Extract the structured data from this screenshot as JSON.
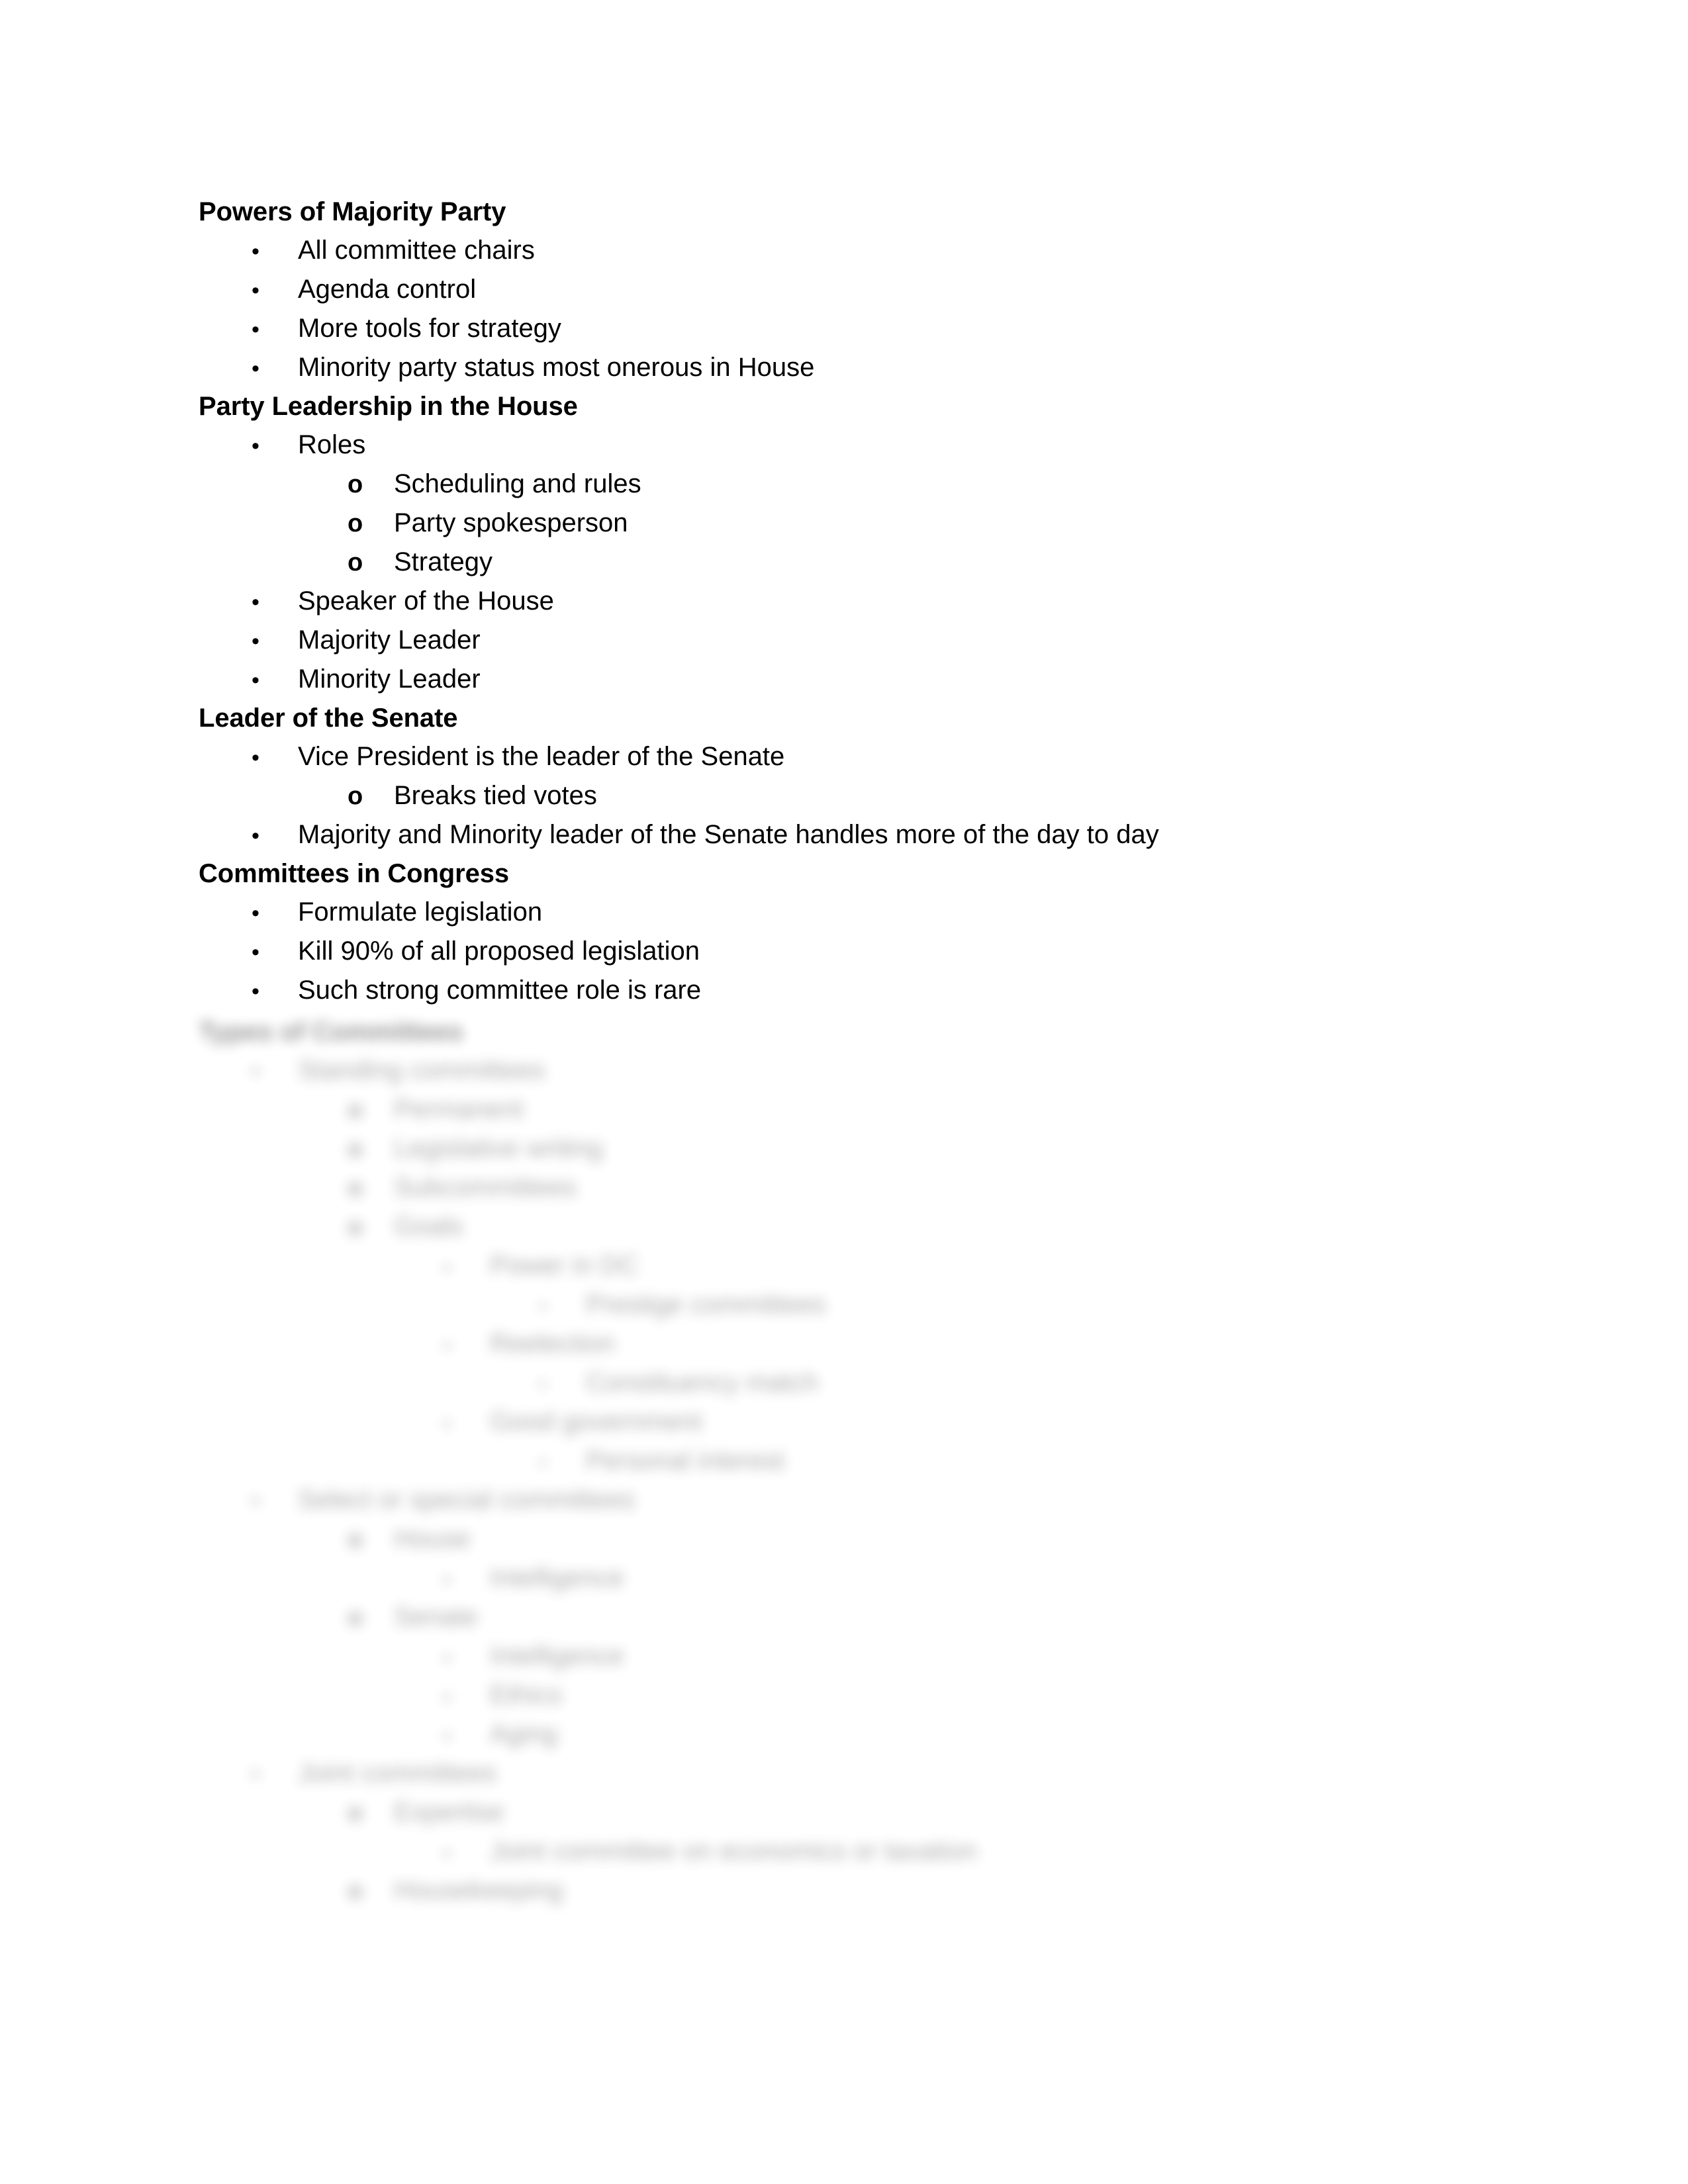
{
  "document": {
    "page_background": "#ffffff",
    "text_color": "#000000",
    "sections": [
      {
        "heading": "Powers of Majority Party",
        "items": [
          {
            "level": 1,
            "marker": "•",
            "text": "All committee chairs"
          },
          {
            "level": 1,
            "marker": "•",
            "text": "Agenda control"
          },
          {
            "level": 1,
            "marker": "•",
            "text": "More tools for strategy"
          },
          {
            "level": 1,
            "marker": "•",
            "text": "Minority party status most onerous in House"
          }
        ]
      },
      {
        "heading": "Party Leadership in the House",
        "items": [
          {
            "level": 1,
            "marker": "•",
            "text": "Roles"
          },
          {
            "level": 2,
            "marker": "o",
            "text": "Scheduling and rules"
          },
          {
            "level": 2,
            "marker": "o",
            "text": "Party spokesperson"
          },
          {
            "level": 2,
            "marker": "o",
            "text": "Strategy"
          },
          {
            "level": 1,
            "marker": "•",
            "text": "Speaker of the House"
          },
          {
            "level": 1,
            "marker": "•",
            "text": "Majority Leader"
          },
          {
            "level": 1,
            "marker": "•",
            "text": "Minority Leader"
          }
        ]
      },
      {
        "heading": "Leader of the Senate",
        "items": [
          {
            "level": 1,
            "marker": "•",
            "text": "Vice President is the leader of the Senate"
          },
          {
            "level": 2,
            "marker": "o",
            "text": "Breaks tied votes"
          },
          {
            "level": 1,
            "marker": "•",
            "text": "Majority and Minority leader of the Senate handles more of the day to day"
          }
        ]
      },
      {
        "heading": "Committees in Congress",
        "items": [
          {
            "level": 1,
            "marker": "•",
            "text": "Formulate legislation"
          },
          {
            "level": 1,
            "marker": "•",
            "text": "Kill 90% of all proposed legislation"
          },
          {
            "level": 1,
            "marker": "•",
            "text": "Such strong committee role is rare"
          }
        ]
      },
      {
        "heading": "Types of Committees",
        "obscured": true,
        "items": [
          {
            "level": 1,
            "marker": "•",
            "text": "Standing committees"
          },
          {
            "level": 2,
            "marker": "o",
            "text": "Permanent"
          },
          {
            "level": 2,
            "marker": "o",
            "text": "Legislative writing"
          },
          {
            "level": 2,
            "marker": "o",
            "text": "Subcommittees"
          },
          {
            "level": 2,
            "marker": "o",
            "text": "Goals"
          },
          {
            "level": 3,
            "marker": "▪",
            "text": "Power in DC"
          },
          {
            "level": 4,
            "marker": "•",
            "text": "Prestige committees"
          },
          {
            "level": 3,
            "marker": "▪",
            "text": "Reelection"
          },
          {
            "level": 4,
            "marker": "•",
            "text": "Constituency match"
          },
          {
            "level": 3,
            "marker": "▪",
            "text": "Good government"
          },
          {
            "level": 4,
            "marker": "•",
            "text": "Personal interest"
          },
          {
            "level": 1,
            "marker": "•",
            "text": "Select or special committees"
          },
          {
            "level": 2,
            "marker": "o",
            "text": "House"
          },
          {
            "level": 3,
            "marker": "▪",
            "text": "Intelligence"
          },
          {
            "level": 2,
            "marker": "o",
            "text": "Senate"
          },
          {
            "level": 3,
            "marker": "▪",
            "text": "Intelligence"
          },
          {
            "level": 3,
            "marker": "▪",
            "text": "Ethics"
          },
          {
            "level": 3,
            "marker": "▪",
            "text": "Aging"
          },
          {
            "level": 1,
            "marker": "•",
            "text": "Joint committees"
          },
          {
            "level": 2,
            "marker": "o",
            "text": "Expertise"
          },
          {
            "level": 3,
            "marker": "▪",
            "text": "Joint committee on economics or taxation"
          },
          {
            "level": 2,
            "marker": "o",
            "text": "Housekeeping"
          }
        ]
      }
    ]
  }
}
